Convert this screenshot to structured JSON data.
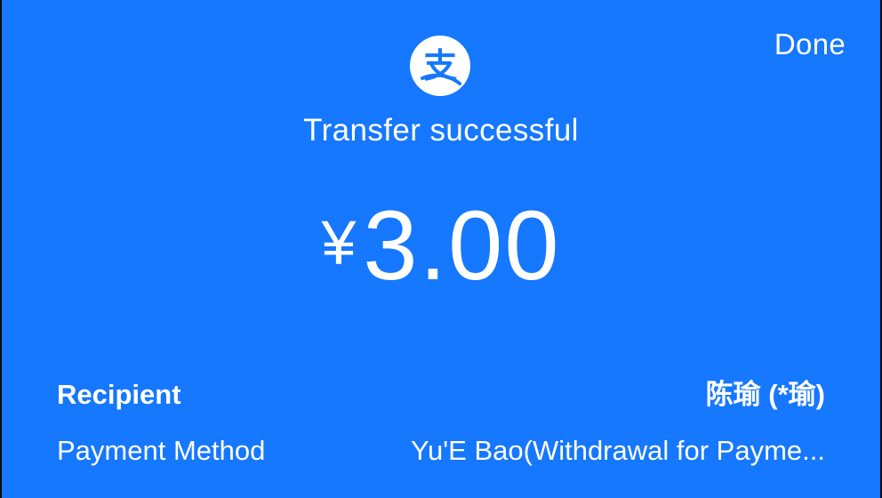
{
  "header": {
    "done_label": "Done"
  },
  "logo": {
    "icon": "alipay-logo-icon",
    "glyph": "支"
  },
  "status": {
    "title": "Transfer successful"
  },
  "amount": {
    "currency_symbol": "¥",
    "value": "3.00"
  },
  "details": {
    "recipient_label": "Recipient",
    "recipient_value": "陈瑜 (*瑜)",
    "payment_method_label": "Payment Method",
    "payment_method_value": "Yu'E Bao(Withdrawal for Payme..."
  },
  "colors": {
    "background": "#1677ff",
    "text": "#ffffff",
    "logo_bg": "#ffffff",
    "logo_fg": "#1677ff"
  }
}
